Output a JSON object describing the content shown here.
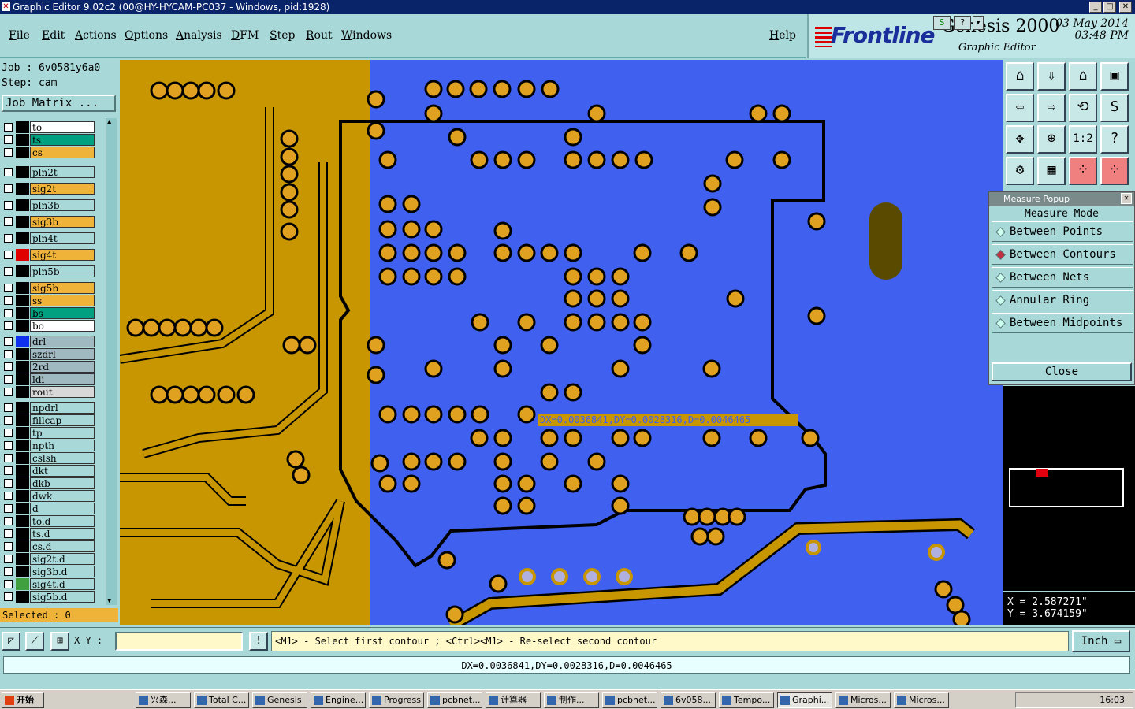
{
  "window": {
    "title": "Graphic Editor 9.02c2 (00@HY-HYCAM-PC037 - Windows, pid:1928)"
  },
  "menu": [
    "File",
    "Edit",
    "Actions",
    "Options",
    "Analysis",
    "DFM",
    "Step",
    "Rout",
    "Windows"
  ],
  "help": "Help",
  "brand": {
    "logo": "Frontline",
    "product": "Genesis 2000",
    "subtitle": "Graphic Editor",
    "date": "03 May 2014",
    "time": "03:48 PM"
  },
  "job": {
    "job_label": "Job : 6v0581y6a0",
    "step_label": "Step: cam",
    "matrix_button": "Job Matrix ..."
  },
  "layers": [
    {
      "name": "to",
      "color": "#ffffff"
    },
    {
      "name": "ts",
      "color": "#00a080"
    },
    {
      "name": "cs",
      "color": "#f0b33a"
    },
    {
      "name": "pln2t",
      "color": "#a8d8d8"
    },
    {
      "name": "sig2t",
      "color": "#f0b33a"
    },
    {
      "name": "pln3b",
      "color": "#a8d8d8"
    },
    {
      "name": "sig3b",
      "color": "#f0b33a"
    },
    {
      "name": "pln4t",
      "color": "#a8d8d8"
    },
    {
      "name": "sig4t",
      "color": "#f0b33a",
      "active": true
    },
    {
      "name": "pln5b",
      "color": "#a8d8d8"
    },
    {
      "name": "sig5b",
      "color": "#f0b33a"
    },
    {
      "name": "ss",
      "color": "#f0b33a"
    },
    {
      "name": "bs",
      "color": "#00a080"
    },
    {
      "name": "bo",
      "color": "#ffffff"
    },
    {
      "name": "drl",
      "color": "#a0b8c0"
    },
    {
      "name": "szdrl",
      "color": "#a0b8c0"
    },
    {
      "name": "2rd",
      "color": "#a0b8c0"
    },
    {
      "name": "ldi",
      "color": "#a0b8c0"
    },
    {
      "name": "rout",
      "color": "#d8d8d8"
    },
    {
      "name": "npdrl",
      "color": "#a8d8d8"
    },
    {
      "name": "fillcap",
      "color": "#a8d8d8"
    },
    {
      "name": "tp",
      "color": "#a8d8d8"
    },
    {
      "name": "npth",
      "color": "#a8d8d8"
    },
    {
      "name": "cslsh",
      "color": "#a8d8d8"
    },
    {
      "name": "dkt",
      "color": "#a8d8d8"
    },
    {
      "name": "dkb",
      "color": "#a8d8d8"
    },
    {
      "name": "dwk",
      "color": "#a8d8d8"
    },
    {
      "name": "d",
      "color": "#a8d8d8"
    },
    {
      "name": "to.d",
      "color": "#a8d8d8"
    },
    {
      "name": "ts.d",
      "color": "#a8d8d8"
    },
    {
      "name": "cs.d",
      "color": "#a8d8d8"
    },
    {
      "name": "sig2t.d",
      "color": "#a8d8d8"
    },
    {
      "name": "sig3b.d",
      "color": "#a8d8d8"
    },
    {
      "name": "sig4t.d",
      "color": "#a8d8d8"
    },
    {
      "name": "sig5b.d",
      "color": "#a8d8d8"
    }
  ],
  "selected": "Selected : 0",
  "measure": {
    "readout": "DX=0.0036841,DY=0.0028316,D=0.0046465"
  },
  "popup": {
    "title": "Measure Popup",
    "mode_title": "Measure Mode",
    "options": [
      "Between Points",
      "Between Contours",
      "Between Nets",
      "Annular Ring",
      "Between Midpoints"
    ],
    "selected_option": "Between Contours",
    "close": "Close"
  },
  "coords": {
    "x": "X = 2.587271\"",
    "y": "Y = 3.674159\""
  },
  "cmd": {
    "xy_label": "X Y :",
    "prompt": "<M1> - Select first contour ; <Ctrl><M1> - Re-select second contour",
    "units": "Inch"
  },
  "status": "DX=0.0036841,DY=0.0028316,D=0.0046465",
  "taskbar": {
    "start": "开始",
    "tasks": [
      "兴森...",
      "Total C...",
      "Genesis",
      "Engine...",
      "Progress",
      "pcbnet...",
      "计算器",
      "制作...",
      "pcbnet...",
      "6v058...",
      "Tempo...",
      "Graphi...",
      "Micros...",
      "Micros..."
    ],
    "active": "Graphi...",
    "clock": "16:03"
  },
  "colors": {
    "board_blue": "#4060f0",
    "copper": "#c89600",
    "pad": "#e0a020",
    "accent_red": "#d00000"
  }
}
